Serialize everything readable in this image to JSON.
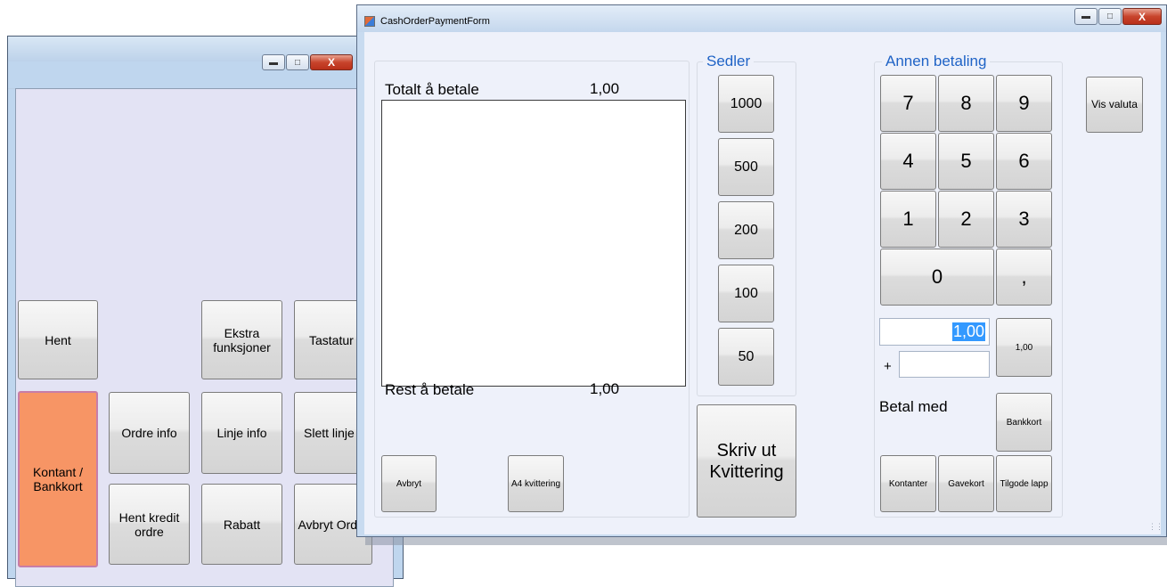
{
  "background_window": {
    "buttons": [
      {
        "id": "hent",
        "label": "Hent"
      },
      {
        "id": "ekstra",
        "label": "Ekstra funksjoner"
      },
      {
        "id": "tastatur",
        "label": "Tastatur"
      },
      {
        "id": "kontant",
        "label": "Kontant / Bankkort"
      },
      {
        "id": "ordreinfo",
        "label": "Ordre info"
      },
      {
        "id": "linjeinfo",
        "label": "Linje info"
      },
      {
        "id": "slettlinje",
        "label": "Slett linje"
      },
      {
        "id": "hentkredit",
        "label": "Hent kredit ordre"
      },
      {
        "id": "rabatt",
        "label": "Rabatt"
      },
      {
        "id": "avbrytordre",
        "label": "Avbryt Ordre"
      }
    ],
    "accent_color": "#f79565"
  },
  "payment_form": {
    "title": "CashOrderPaymentForm",
    "total_label": "Totalt å betale",
    "total_value": "1,00",
    "rest_label": "Rest å betale",
    "rest_value": "1,00",
    "cancel_label": "Avbryt",
    "a4_receipt_label": "A4 kvittering",
    "notes_group_title": "Sedler",
    "notes": [
      "1000",
      "500",
      "200",
      "100",
      "50"
    ],
    "print_receipt_label": "Skriv ut Kvittering",
    "other_payment_title": "Annen betaling",
    "keypad": [
      "7",
      "8",
      "9",
      "4",
      "5",
      "6",
      "1",
      "2",
      "3",
      "0",
      ","
    ],
    "amount_value": "1,00",
    "plus_label": "+",
    "plus_value": "",
    "quick_amount_label": "1,00",
    "pay_with_label": "Betal med",
    "bankkort_label": "Bankkort",
    "kontanter_label": "Kontanter",
    "gavekort_label": "Gavekort",
    "tilgode_label": "Tilgode lapp",
    "vis_valuta_label": "Vis valuta"
  },
  "caption_icons": [
    "minimize-icon",
    "maximize-icon",
    "close-icon"
  ]
}
